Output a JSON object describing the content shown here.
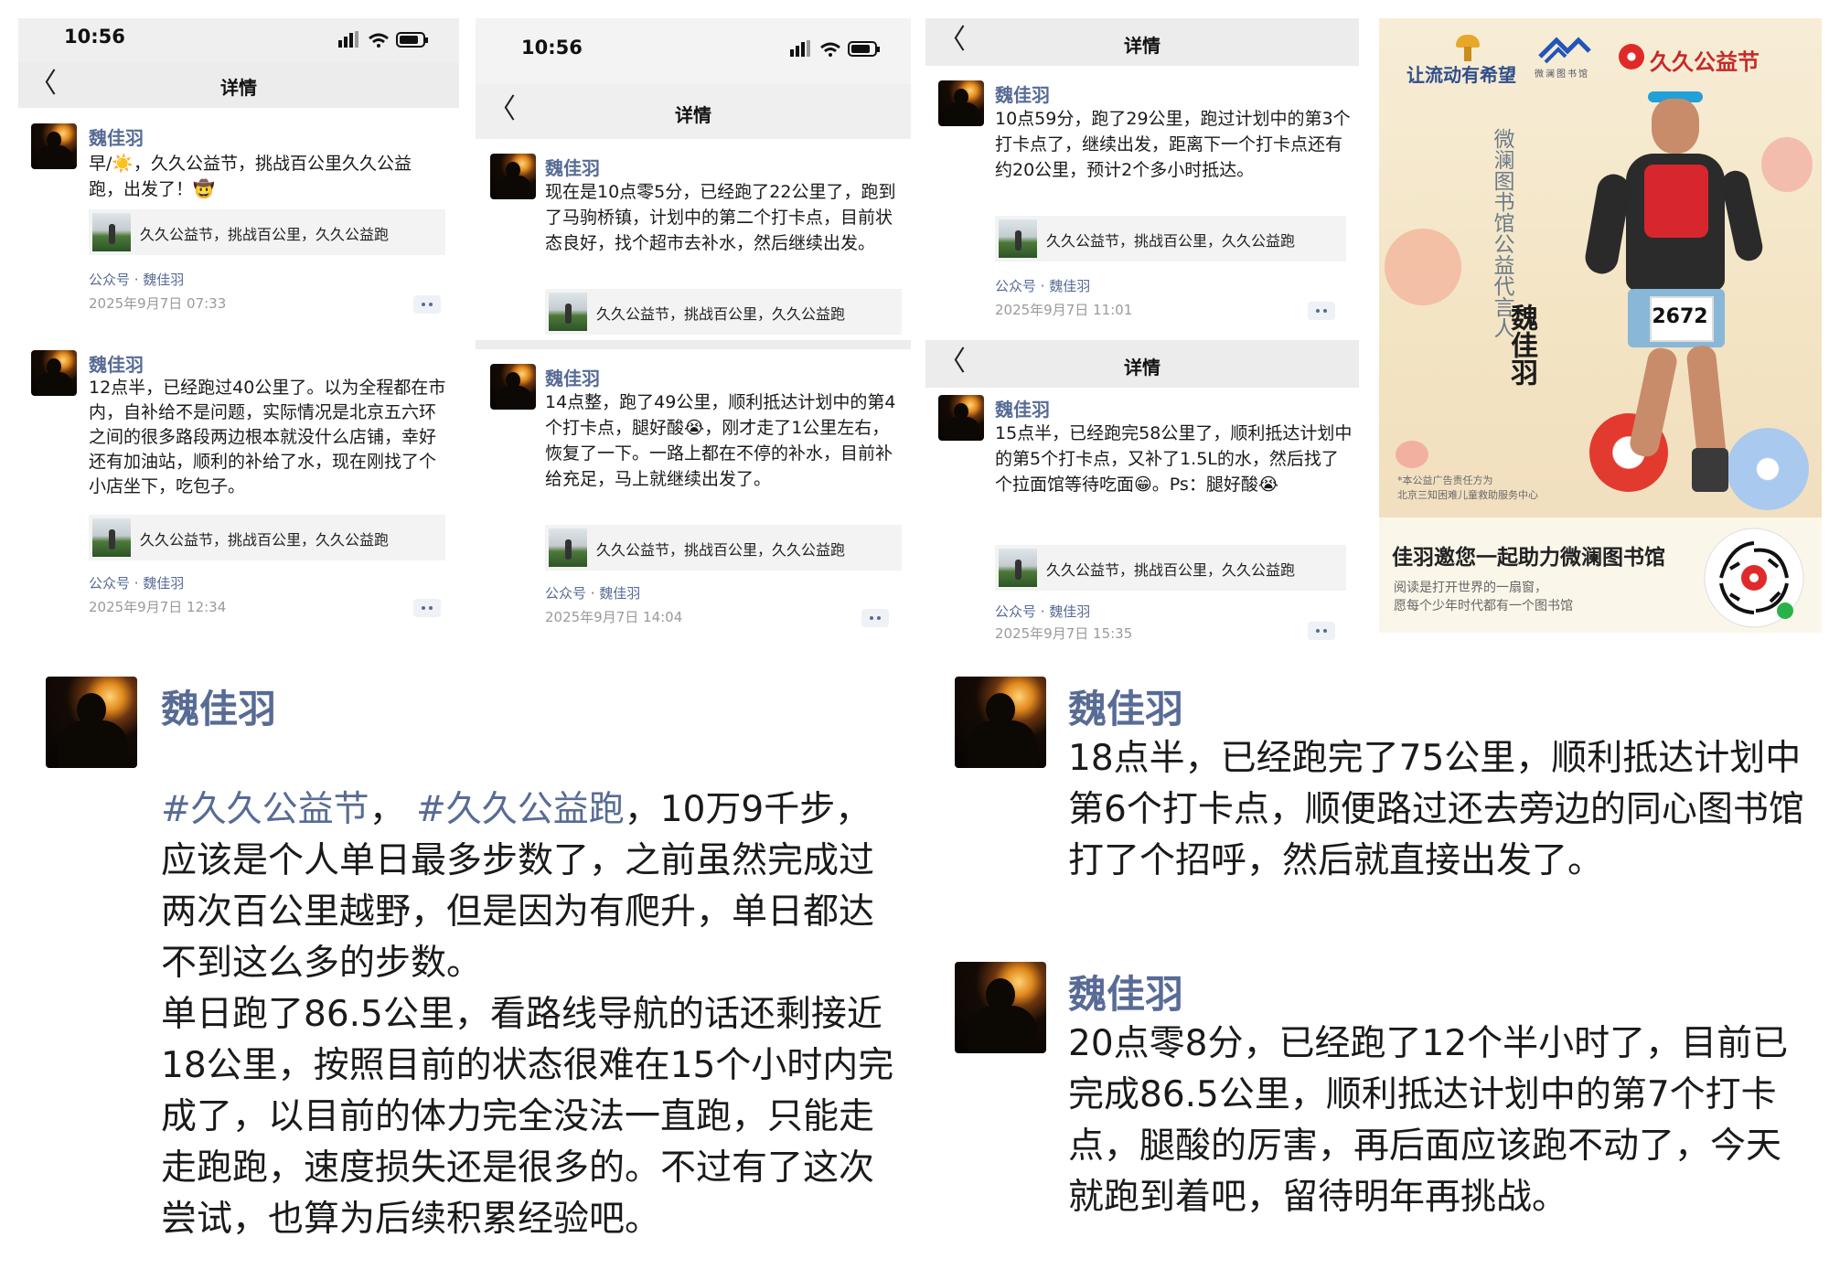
{
  "username": "魏佳羽",
  "nav_title": "详情",
  "link_card_text": "久久公益节，挑战百公里，久久公益跑",
  "source": "公众号 · 魏佳羽",
  "back_glyph": "〈",
  "shot1": {
    "time": "10:56",
    "posts": [
      {
        "text": "早/☀️，久久公益节，挑战百公里久久公益跑，出发了！🤠",
        "timestamp": "2025年9月7日 07:33"
      },
      {
        "text": "12点半，已经跑过40公里了。以为全程都在市内，自补给不是问题，实际情况是北京五六环之间的很多路段两边根本就没什么店铺，幸好还有加油站，顺利的补给了水，现在刚找了个小店坐下，吃包子。",
        "timestamp": "2025年9月7日 12:34"
      }
    ]
  },
  "shot2": {
    "time": "10:56",
    "posts": [
      {
        "text": "现在是10点零5分，已经跑了22公里了，跑到了马驹桥镇，计划中的第二个打卡点，目前状态良好，找个超市去补水，然后继续出发。"
      },
      {
        "text": "14点整，跑了49公里，顺利抵达计划中的第4个打卡点，腿好酸😭，刚才走了1公里左右，恢复了一下。一路上都在不停的补水，目前补给充足，马上就继续出发了。",
        "timestamp": "2025年9月7日 14:04"
      }
    ]
  },
  "shot3": {
    "posts": [
      {
        "text": "10点59分，跑了29公里，跑过计划中的第3个打卡点了，继续出发，距离下一个打卡点还有约20公里，预计2个多小时抵达。",
        "timestamp": "2025年9月7日 11:01"
      },
      {
        "text": "15点半，已经跑完58公里了，顺利抵达计划中的第5个打卡点，又补了1.5L的水，然后找了个拉面馆等待吃面😁。Ps：腿好酸😭",
        "timestamp": "2025年9月7日 15:35"
      }
    ]
  },
  "poster": {
    "logo_text_1": "让流动有希望",
    "logo_text_2": "微澜图书馆",
    "brand": "久久公益节",
    "vertical_title": "微澜图书馆公益代言人",
    "name_vertical": "魏佳羽",
    "bib_number": "2672",
    "disclaimer": "*本公益广告责任方为\n北京三知困难儿童救助服务中心",
    "headline": "佳羽邀您一起助力微澜图书馆",
    "sub1": "阅读是打开世界的一扇窗，",
    "sub2": "愿每个少年时代都有一个图书馆"
  },
  "big_left": {
    "hashtag1": "#久久公益节",
    "sep": "， ",
    "hashtag2": "#久久公益跑",
    "text": "，10万9千步，应该是个人单日最多步数了，之前虽然完成过两次百公里越野，但是因为有爬升，单日都达不到这么多的步数。\n单日跑了86.5公里，看路线导航的话还剩接近18公里，按照目前的状态很难在15个小时内完成了，以目前的体力完全没法一直跑，只能走走跑跑，速度损失还是很多的。不过有了这次尝试，也算为后续积累经验吧。"
  },
  "big_right_1": {
    "text": "18点半，已经跑完了75公里，顺利抵达计划中第6个打卡点，顺便路过还去旁边的同心图书馆打了个招呼，然后就直接出发了。"
  },
  "big_right_2": {
    "text": "20点零8分，已经跑了12个半小时了，目前已完成86.5公里，顺利抵达计划中的第7个打卡点，腿酸的厉害，再后面应该跑不动了，今天就跑到着吧，留待明年再挑战。"
  }
}
